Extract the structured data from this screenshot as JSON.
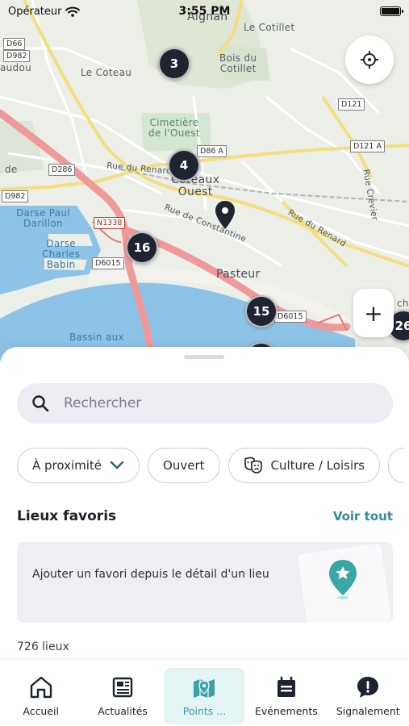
{
  "status_bar": {
    "carrier": "Opérateur",
    "time": "3:55 PM"
  },
  "map": {
    "labels": {
      "aignan": "Aignan",
      "le_cotillet": "Le Cotillet",
      "bois_du_cotillet": "Bois du\nCotillet",
      "le_coteau": "Le Coteau",
      "cimetiere": "Cimetière\nde l'Ouest",
      "coteaux_ouest": "Coteaux\nOuest",
      "rue_du_renard_1": "Rue du Renard",
      "rue_du_renard_2": "Rue du Renard",
      "rue_de_constantine": "Rue de Constantine",
      "rue_crevier": "Rue Crevier",
      "darse_paul_darillon": "Darse Paul\nDarillon",
      "darse_charles_babin": "Darse\nCharles\nBabin",
      "pasteur": "Pasteur",
      "bassin_aux": "Bassin aux",
      "de": "de",
      "audou": "audou",
      "ch": "ch"
    },
    "roads": [
      "D66",
      "D982",
      "D121",
      "D121 A",
      "D86 A",
      "D286",
      "D982",
      "N1338",
      "D6015",
      "D6015"
    ],
    "clusters": [
      "3",
      "4",
      "16",
      "15",
      "26"
    ],
    "zoom_in_label": "+"
  },
  "sheet": {
    "search_placeholder": "Rechercher",
    "filters": [
      "À proximité",
      "Ouvert",
      "Culture / Loisirs"
    ],
    "favorites_title": "Lieux favoris",
    "favorites_link": "Voir tout",
    "favorites_empty_text": "Ajouter un favori depuis le détail d'un lieu",
    "count_text": "726 lieux"
  },
  "tabs": [
    {
      "label": "Accueil",
      "icon": "home-icon",
      "active": false
    },
    {
      "label": "Actualités",
      "icon": "newspaper-icon",
      "active": false
    },
    {
      "label": "Points ...",
      "icon": "map-pin-icon",
      "active": true
    },
    {
      "label": "Evénements",
      "icon": "calendar-icon",
      "active": false
    },
    {
      "label": "Signalement",
      "icon": "alert-bubble-icon",
      "active": false
    }
  ],
  "colors": {
    "accent": "#38a1a6",
    "cluster": "#1f2530",
    "water": "#8ec3e8",
    "highway": "#ef9a9a"
  }
}
